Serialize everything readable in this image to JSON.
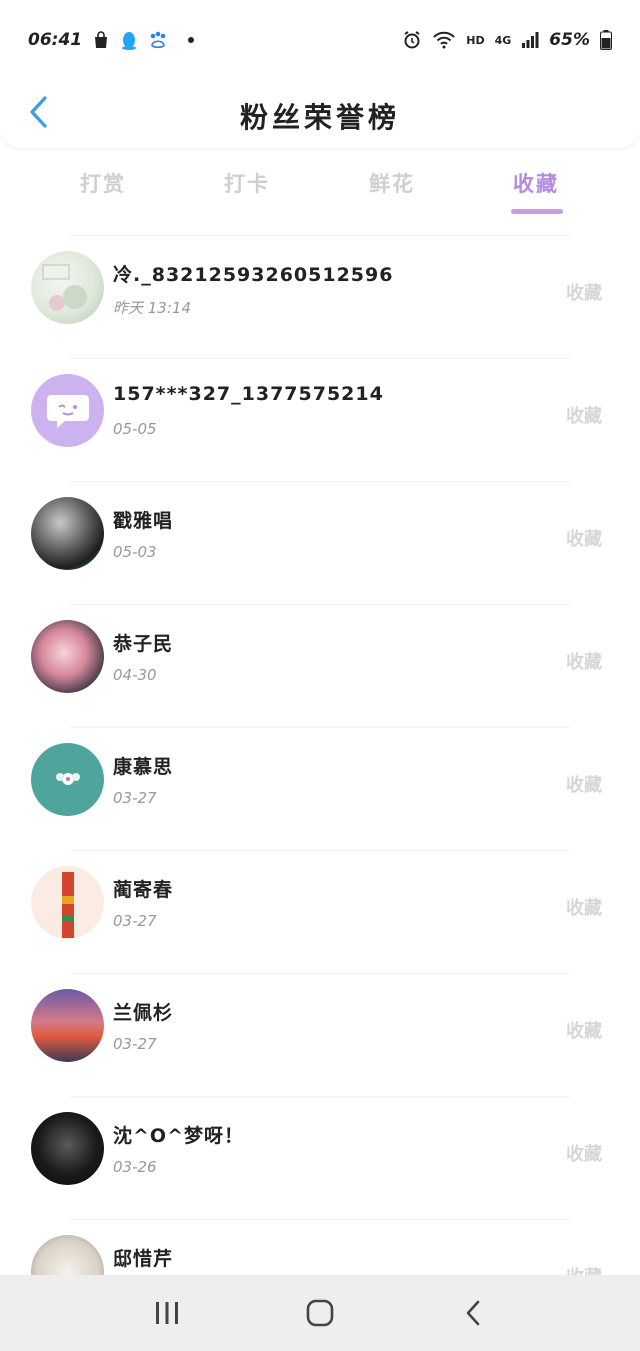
{
  "status_bar": {
    "time": "06:41",
    "network_badge": "HD",
    "signal_label": "4G",
    "battery": "65%"
  },
  "header": {
    "title": "粉丝荣誉榜"
  },
  "tabs": [
    {
      "label": "打赏",
      "active": false
    },
    {
      "label": "打卡",
      "active": false
    },
    {
      "label": "鲜花",
      "active": false
    },
    {
      "label": "收藏",
      "active": true
    }
  ],
  "list": [
    {
      "name": "冷._83212593260512596",
      "date": "昨天 13:14",
      "action": "收藏"
    },
    {
      "name": "157***327_1377575214",
      "date": "05-05",
      "action": "收藏"
    },
    {
      "name": "戳雅唱",
      "date": "05-03",
      "action": "收藏"
    },
    {
      "name": "恭子民",
      "date": "04-30",
      "action": "收藏"
    },
    {
      "name": "康慕思",
      "date": "03-27",
      "action": "收藏"
    },
    {
      "name": "蔺寄春",
      "date": "03-27",
      "action": "收藏"
    },
    {
      "name": "兰佩杉",
      "date": "03-27",
      "action": "收藏"
    },
    {
      "name": "沈^O^梦呀！",
      "date": "03-26",
      "action": "收藏"
    },
    {
      "name": "邸惜芹",
      "date": "",
      "action": "收藏"
    }
  ],
  "colors": {
    "accent": "#b58be0",
    "back_arrow": "#3a9ee0",
    "inactive_tab": "#cfcfcf"
  }
}
